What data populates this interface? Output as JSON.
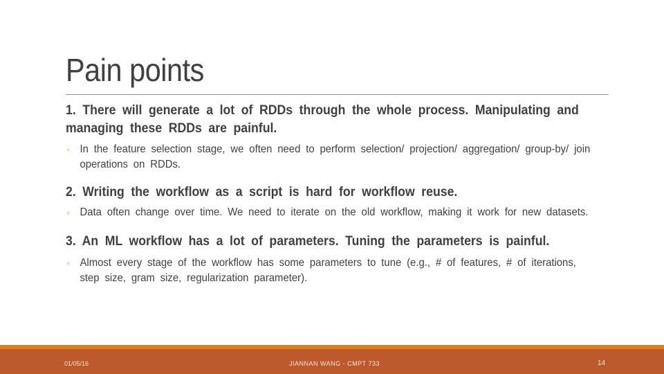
{
  "slide": {
    "title": "Pain points",
    "points": [
      {
        "text": "1. There will generate a lot of RDDs through the whole process. Manipulating and managing these RDDs are painful.",
        "sub": "In the feature selection stage, we often need to perform selection/ projection/ aggregation/ group-by/ join operations on RDDs."
      },
      {
        "text": "2. Writing the workflow as a script is hard for workflow reuse.",
        "sub": "Data often change over time. We need to iterate on the old workflow, making it work for new datasets."
      },
      {
        "text": "3. An ML workflow has a lot of parameters. Tuning the parameters is painful.",
        "sub": "Almost every stage of the workflow has some parameters to tune (e.g., # of features, # of iterations, step size, gram size, regularization parameter)."
      }
    ],
    "bullet_glyph": "◦"
  },
  "footer": {
    "date": "01/05/16",
    "author": "JIANNAN WANG - CMPT 733",
    "page": "14"
  },
  "colors": {
    "accent": "#e07f1f",
    "footer_bg": "#bc5a2d",
    "text": "#404040"
  }
}
